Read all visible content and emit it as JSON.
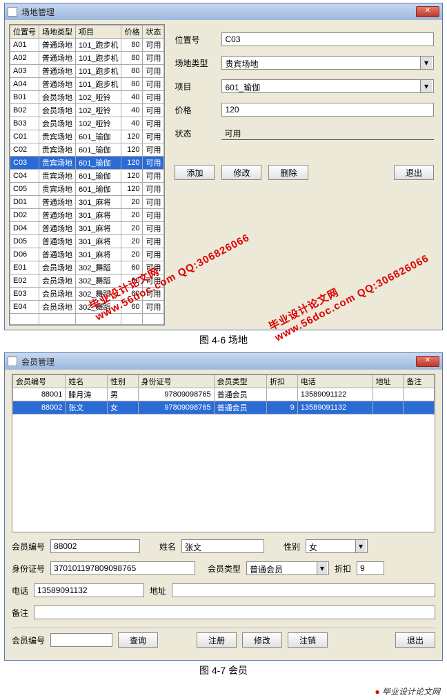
{
  "win1": {
    "title": "场地管理",
    "cols": [
      "位置号",
      "场地类型",
      "项目",
      "价格",
      "状态"
    ],
    "rows": [
      {
        "id": "A01",
        "type": "普通场地",
        "proj": "101_跑步机",
        "price": 80,
        "st": "可用"
      },
      {
        "id": "A02",
        "type": "普通场地",
        "proj": "101_跑步机",
        "price": 80,
        "st": "可用"
      },
      {
        "id": "A03",
        "type": "普通场地",
        "proj": "101_跑步机",
        "price": 80,
        "st": "可用"
      },
      {
        "id": "A04",
        "type": "普通场地",
        "proj": "101_跑步机",
        "price": 80,
        "st": "可用"
      },
      {
        "id": "B01",
        "type": "会员场地",
        "proj": "102_哑铃",
        "price": 40,
        "st": "可用"
      },
      {
        "id": "B02",
        "type": "会员场地",
        "proj": "102_哑铃",
        "price": 40,
        "st": "可用"
      },
      {
        "id": "B03",
        "type": "会员场地",
        "proj": "102_哑铃",
        "price": 40,
        "st": "可用"
      },
      {
        "id": "C01",
        "type": "贵宾场地",
        "proj": "601_瑜伽",
        "price": 120,
        "st": "可用"
      },
      {
        "id": "C02",
        "type": "贵宾场地",
        "proj": "601_瑜伽",
        "price": 120,
        "st": "可用"
      },
      {
        "id": "C03",
        "type": "贵宾场地",
        "proj": "601_瑜伽",
        "price": 120,
        "st": "可用",
        "sel": true
      },
      {
        "id": "C04",
        "type": "贵宾场地",
        "proj": "601_瑜伽",
        "price": 120,
        "st": "可用"
      },
      {
        "id": "C05",
        "type": "贵宾场地",
        "proj": "601_瑜伽",
        "price": 120,
        "st": "可用"
      },
      {
        "id": "D01",
        "type": "普通场地",
        "proj": "301_麻将",
        "price": 20,
        "st": "可用"
      },
      {
        "id": "D02",
        "type": "普通场地",
        "proj": "301_麻将",
        "price": 20,
        "st": "可用"
      },
      {
        "id": "D04",
        "type": "普通场地",
        "proj": "301_麻将",
        "price": 20,
        "st": "可用"
      },
      {
        "id": "D05",
        "type": "普通场地",
        "proj": "301_麻将",
        "price": 20,
        "st": "可用"
      },
      {
        "id": "D06",
        "type": "普通场地",
        "proj": "301_麻将",
        "price": 20,
        "st": "可用"
      },
      {
        "id": "E01",
        "type": "会员场地",
        "proj": "302_舞蹈",
        "price": 60,
        "st": "可用"
      },
      {
        "id": "E02",
        "type": "会员场地",
        "proj": "302_舞蹈",
        "price": 60,
        "st": "可用"
      },
      {
        "id": "E03",
        "type": "会员场地",
        "proj": "302_舞蹈",
        "price": 60,
        "st": "可用"
      },
      {
        "id": "E04",
        "type": "会员场地",
        "proj": "302_舞蹈",
        "price": 60,
        "st": "可用"
      }
    ],
    "form": {
      "l_pos": "位置号",
      "pos": "C03",
      "l_type": "场地类型",
      "type": "贵宾场地",
      "l_proj": "项目",
      "proj": "601_瑜伽",
      "l_price": "价格",
      "price": "120",
      "l_status": "状态",
      "status": "可用"
    },
    "btns": {
      "add": "添加",
      "mod": "修改",
      "del": "删除",
      "exit": "退出"
    }
  },
  "cap1": "图 4-6  场地",
  "win2": {
    "title": "会员管理",
    "cols": [
      "会员编号",
      "姓名",
      "性别",
      "身份证号",
      "会员类型",
      "折扣",
      "电话",
      "地址",
      "备注"
    ],
    "rows": [
      {
        "id": 88001,
        "name": "滕月涛",
        "sex": "男",
        "idcard": "97809098765",
        "mtype": "普通会员",
        "disc": "",
        "tel": "13589091122",
        "addr": "",
        "note": ""
      },
      {
        "id": 88002,
        "name": "张文",
        "sex": "女",
        "idcard": "97809098765",
        "mtype": "普通会员",
        "disc": "9",
        "tel": "13589091132",
        "addr": "",
        "note": "",
        "sel": true
      }
    ],
    "form": {
      "l_id": "会员编号",
      "id": "88002",
      "l_name": "姓名",
      "name": "张文",
      "l_sex": "性别",
      "sex": "女",
      "l_idcard": "身份证号",
      "idcard": "370101197809098765",
      "l_mtype": "会员类型",
      "mtype": "普通会员",
      "l_disc": "折扣",
      "disc": "9",
      "l_tel": "电话",
      "tel": "13589091132",
      "l_addr": "地址",
      "addr": "",
      "l_note": "备注",
      "note": "",
      "l_qid": "会员编号",
      "qid": ""
    },
    "btns": {
      "query": "查询",
      "reg": "注册",
      "mod": "修改",
      "unreg": "注销",
      "exit": "退出"
    }
  },
  "cap2": "图 4-7 会员",
  "watermark": {
    "a": "毕业设计论文网",
    "b": "www.56doc.com   QQ:306826066"
  },
  "footer": "毕业设计论文网"
}
